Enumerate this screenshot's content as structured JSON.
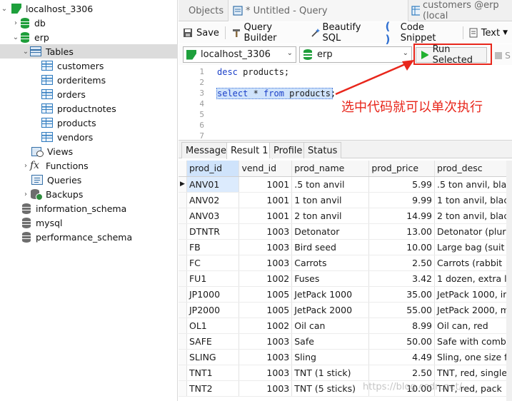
{
  "sidebar": {
    "connection": "localhost_3306",
    "databases": {
      "db": "db",
      "erp": "erp",
      "tables_label": "Tables",
      "tables": [
        "customers",
        "orderitems",
        "orders",
        "productnotes",
        "products",
        "vendors"
      ],
      "views": "Views",
      "functions": "Functions",
      "queries": "Queries",
      "backups": "Backups",
      "information_schema": "information_schema",
      "mysql": "mysql",
      "performance_schema": "performance_schema"
    }
  },
  "tabs": {
    "objects": "Objects",
    "query": "* Untitled - Query",
    "customers": "customers @erp (local"
  },
  "toolbar": {
    "save": "Save",
    "query_builder": "Query Builder",
    "beautify": "Beautify SQL",
    "snippet": "Code Snippet",
    "text": "Text",
    "run_selected": "Run Selected",
    "stop_partial": "S"
  },
  "connection_row": {
    "connection": "localhost_3306",
    "database": "erp"
  },
  "editor": {
    "line_numbers": [
      "1",
      "2",
      "3",
      "4",
      "5",
      "6",
      "7"
    ],
    "line1_kw": "desc",
    "line1_rest": " products;",
    "line3_kw1": "select",
    "line3_mid": " * ",
    "line3_kw2": "from",
    "line3_rest": " products;"
  },
  "annotation": "选中代码就可以单次执行",
  "result_tabs": [
    "Message",
    "Result 1",
    "Profile",
    "Status"
  ],
  "grid": {
    "columns": [
      "prod_id",
      "vend_id",
      "prod_name",
      "prod_price",
      "prod_desc"
    ],
    "rows": [
      [
        "ANV01",
        "1001",
        ".5 ton anvil",
        "5.99",
        ".5 ton anvil, bla"
      ],
      [
        "ANV02",
        "1001",
        "1 ton anvil",
        "9.99",
        "1 ton anvil, blac"
      ],
      [
        "ANV03",
        "1001",
        "2 ton anvil",
        "14.99",
        "2 ton anvil, blac"
      ],
      [
        "DTNTR",
        "1003",
        "Detonator",
        "13.00",
        "Detonator (plur"
      ],
      [
        "FB",
        "1003",
        "Bird seed",
        "10.00",
        "Large bag (suit"
      ],
      [
        "FC",
        "1003",
        "Carrots",
        "2.50",
        "Carrots (rabbit"
      ],
      [
        "FU1",
        "1002",
        "Fuses",
        "3.42",
        "1 dozen, extra l"
      ],
      [
        "JP1000",
        "1005",
        "JetPack 1000",
        "35.00",
        "JetPack 1000, in"
      ],
      [
        "JP2000",
        "1005",
        "JetPack 2000",
        "55.00",
        "JetPack 2000, m"
      ],
      [
        "OL1",
        "1002",
        "Oil can",
        "8.99",
        "Oil can, red"
      ],
      [
        "SAFE",
        "1003",
        "Safe",
        "50.00",
        "Safe with comb"
      ],
      [
        "SLING",
        "1003",
        "Sling",
        "4.49",
        "Sling, one size f"
      ],
      [
        "TNT1",
        "1003",
        "TNT (1 stick)",
        "2.50",
        "TNT, red, single"
      ],
      [
        "TNT2",
        "1003",
        "TNT (5 sticks)",
        "10.00",
        "TNT, red, pack"
      ]
    ]
  },
  "watermark": "https://blog.csdn.net/...",
  "colors": {
    "accent_red": "#e8261b",
    "db_green": "#1e9e3a",
    "selection_blue": "#cfe3fb"
  }
}
